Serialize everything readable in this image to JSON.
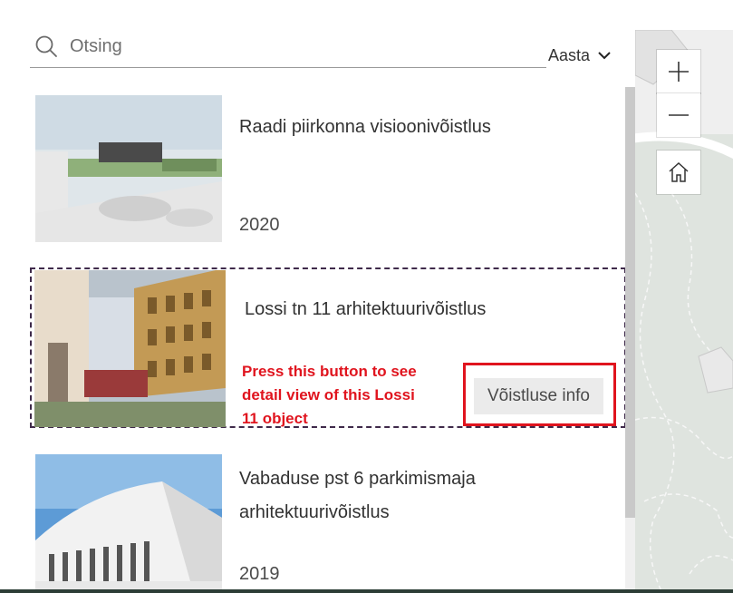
{
  "search": {
    "placeholder": "Otsing"
  },
  "sort": {
    "label": "Aasta"
  },
  "items": [
    {
      "title": "Raadi piirkonna visioonivõistlus",
      "year": "2020"
    },
    {
      "title": "Lossi tn 11 arhitektuurivõistlus",
      "button_label": "Võistluse info"
    },
    {
      "title_line1": "Vabaduse pst 6 parkimismaja",
      "title_line2": "arhitektuurivõistlus",
      "year": "2019"
    }
  ],
  "annotation": {
    "line1": "Press this button to see",
    "line2": "detail view of this Lossi",
    "line3": "11 object"
  },
  "map": {
    "zoom_in_icon": "plus-icon",
    "zoom_out_icon": "minus-icon",
    "home_icon": "home-icon"
  },
  "colors": {
    "annotation_red": "#e0141e",
    "selection_border": "#3f2a4a",
    "button_bg": "#ebebeb",
    "map_bg": "#dfe4df"
  }
}
